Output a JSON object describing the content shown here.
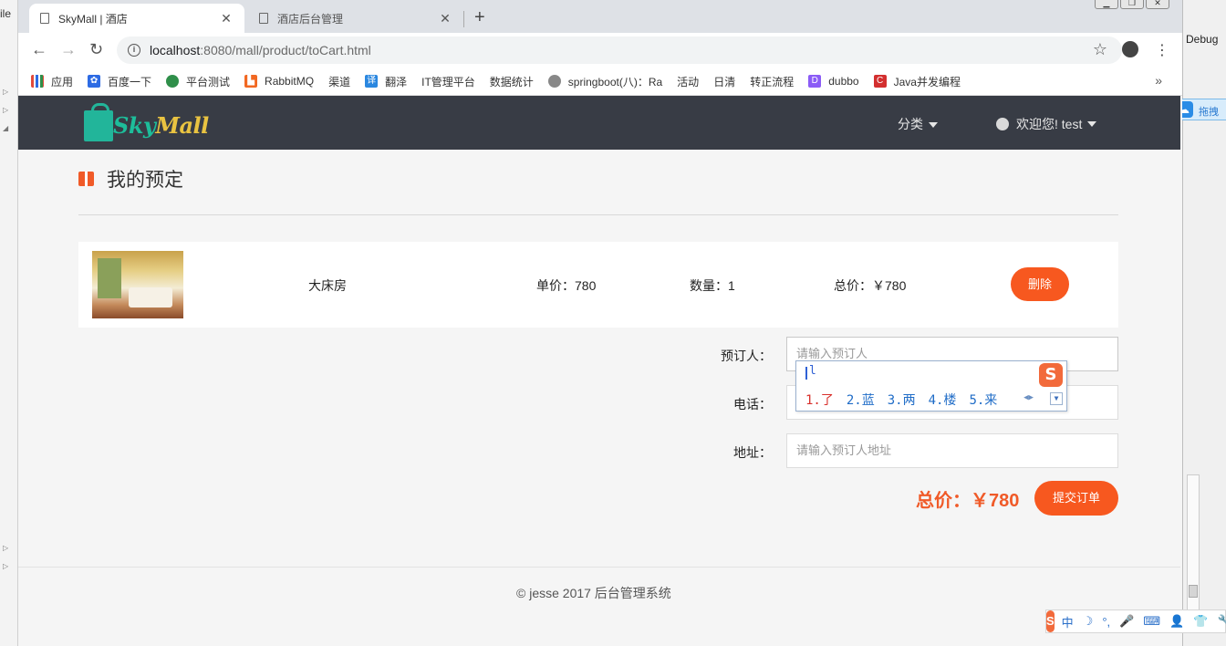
{
  "browser": {
    "tabs": [
      {
        "title": "SkyMall | 酒店"
      },
      {
        "title": "酒店后台管理"
      }
    ],
    "url_host": "localhost",
    "url_path": ":8080/mall/product/toCart.html",
    "bookmarks": [
      {
        "label": "应用",
        "icon": "apps-grid-icon",
        "color": "#e24a3b"
      },
      {
        "label": "百度一下",
        "icon": "baidu-paw-icon",
        "color": "#2d6be4"
      },
      {
        "label": "平台测试",
        "icon": "green-circle-icon",
        "color": "#2f8f4a"
      },
      {
        "label": "RabbitMQ",
        "icon": "rabbitmq-icon",
        "color": "#f26822"
      },
      {
        "label": "渠道",
        "icon": "page-icon"
      },
      {
        "label": "翻泽",
        "icon": "translate-icon",
        "color": "#2a87e0"
      },
      {
        "label": "IT管理平台",
        "icon": "page-icon"
      },
      {
        "label": "数据统计",
        "icon": "page-icon"
      },
      {
        "label": "springboot(八)：Ra",
        "icon": "cloud-icon",
        "color": "#888888"
      },
      {
        "label": "活动",
        "icon": "page-icon"
      },
      {
        "label": "日清",
        "icon": "page-icon"
      },
      {
        "label": "转正流程",
        "icon": "page-icon"
      },
      {
        "label": "dubbo",
        "icon": "dubbo-icon",
        "color": "#8b5cf6"
      },
      {
        "label": "Java并发编程",
        "icon": "c-red-icon",
        "color": "#d32f2f"
      }
    ],
    "more": "»"
  },
  "ide": {
    "left_label": "ile",
    "right_label": "Debug",
    "baidu_label": "拖拽"
  },
  "navbar": {
    "logo_sky": "Sky",
    "logo_mall": "Mall",
    "category": "分类",
    "user": "欢迎您! test"
  },
  "page": {
    "title": "我的预定"
  },
  "cart": {
    "item_name": "大床房",
    "unit_price": "单价：780",
    "quantity": "数量：1",
    "total": "总价：￥780",
    "delete_label": "删除"
  },
  "form": {
    "booker_label": "预订人：",
    "booker_placeholder": "请输入预订人",
    "phone_label": "电话：",
    "address_label": "地址：",
    "address_placeholder": "请输入预订人地址"
  },
  "ime": {
    "preedit": "l",
    "candidates": [
      "1.了",
      "2.蓝",
      "3.两",
      "4.楼",
      "5.来"
    ],
    "status": [
      "中",
      "☽",
      "°,",
      "🎤",
      "⌨",
      "👤",
      "👕",
      "🔧"
    ]
  },
  "summary": {
    "total": "总价：￥780",
    "submit_label": "提交订单"
  },
  "footer": {
    "text": "© jesse 2017  后台管理系统"
  },
  "colors": {
    "accent": "#f7581f",
    "navbar": "#383c45",
    "logo_teal": "#1dbd9a",
    "logo_yellow": "#e9c341"
  }
}
